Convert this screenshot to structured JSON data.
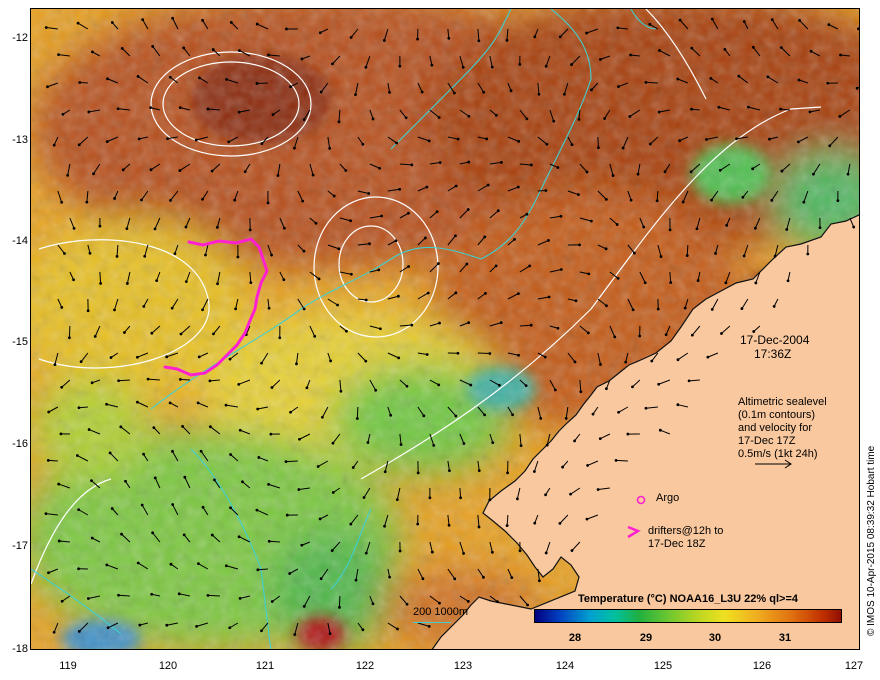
{
  "axes": {
    "y_labels": [
      "-12",
      "-13",
      "-14",
      "-15",
      "-16",
      "-17",
      "-18"
    ],
    "x_labels": [
      "119",
      "120",
      "121",
      "122",
      "123",
      "124",
      "125",
      "126",
      "127"
    ]
  },
  "overlay": {
    "date": "17-Dec-2004",
    "time": "17:36Z",
    "altimetry_lines": [
      "Altimetric sealevel",
      "(0.1m contours)",
      "and velocity for",
      "17-Dec 17Z",
      "0.5m/s (1kt 24h)"
    ],
    "argo_label": "Argo",
    "drifters_lines": [
      "drifters@12h to",
      "17-Dec 18Z"
    ],
    "depth_label": "200  1000m"
  },
  "colorbar": {
    "title": "Temperature (°C) NOAA16_L3U 22% ql>=4",
    "ticks": [
      "28",
      "29",
      "30",
      "31"
    ]
  },
  "credit": "© IMOS 10-Apr-2015 08:39:32 Hobart time",
  "colors": {
    "land": "#f9c89e",
    "sst_warm": "#b8501a",
    "sst_mid": "#e8a020",
    "sst_cool": "#60c040",
    "contour": "#ffffff",
    "isobath": "#40d0d0",
    "drifter": "#ff20d0",
    "arrow": "#000000"
  }
}
